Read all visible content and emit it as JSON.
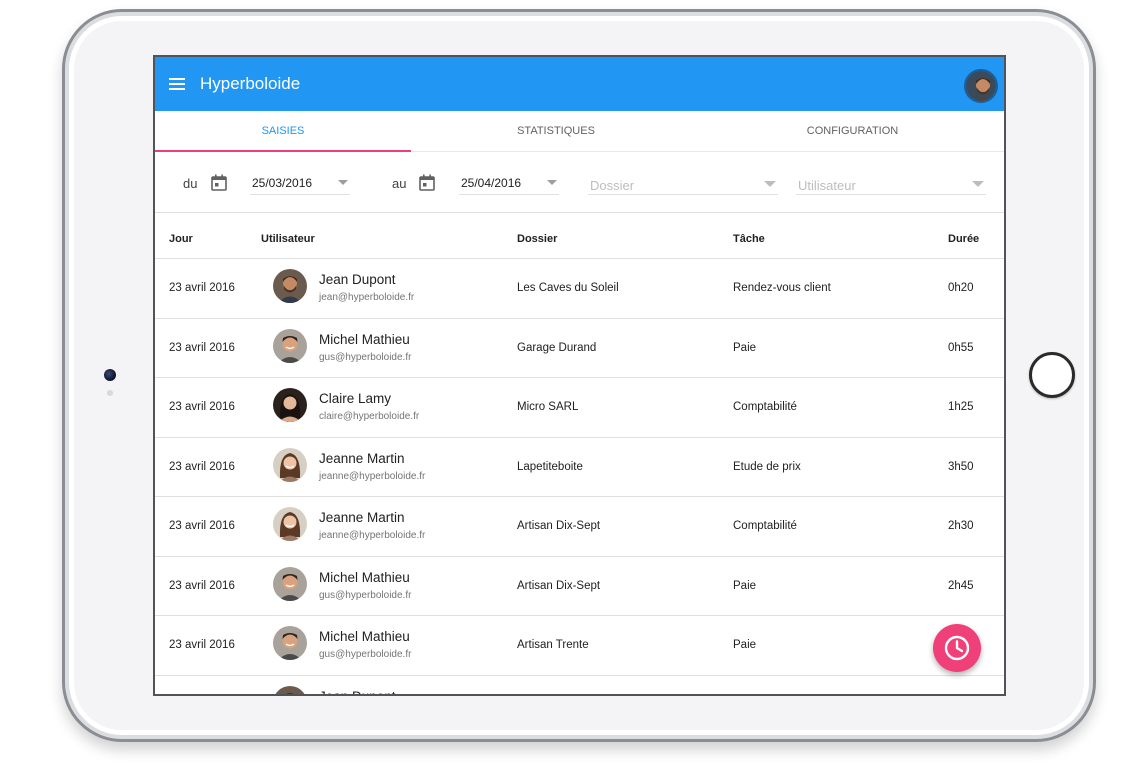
{
  "app": {
    "title": "Hyperboloide"
  },
  "tabs": [
    {
      "label": "Saisies",
      "active": true
    },
    {
      "label": "Statistiques",
      "active": false
    },
    {
      "label": "Configuration",
      "active": false
    }
  ],
  "filters": {
    "from_label": "du",
    "from_date": "25/03/2016",
    "to_label": "au",
    "to_date": "25/04/2016",
    "dossier_placeholder": "Dossier",
    "utilisateur_placeholder": "Utilisateur"
  },
  "table": {
    "headers": {
      "jour": "Jour",
      "utilisateur": "Utilisateur",
      "dossier": "Dossier",
      "tache": "Tâche",
      "duree": "Durée"
    },
    "rows": [
      {
        "jour": "23 avril 2016",
        "name": "Jean Dupont",
        "email": "jean@hyperboloide.fr",
        "dossier": "Les Caves du Soleil",
        "tache": "Rendez-vous client",
        "duree": "0h20",
        "avatar": "man-beard"
      },
      {
        "jour": "23 avril 2016",
        "name": "Michel Mathieu",
        "email": "gus@hyperboloide.fr",
        "dossier": "Garage Durand",
        "tache": "Paie",
        "duree": "0h55",
        "avatar": "man-smile"
      },
      {
        "jour": "23 avril 2016",
        "name": "Claire Lamy",
        "email": "claire@hyperboloide.fr",
        "dossier": "Micro SARL",
        "tache": "Comptabilité",
        "duree": "1h25",
        "avatar": "woman-dark"
      },
      {
        "jour": "23 avril 2016",
        "name": "Jeanne Martin",
        "email": "jeanne@hyperboloide.fr",
        "dossier": "Lapetiteboite",
        "tache": "Etude de prix",
        "duree": "3h50",
        "avatar": "woman-brown"
      },
      {
        "jour": "23 avril 2016",
        "name": "Jeanne Martin",
        "email": "jeanne@hyperboloide.fr",
        "dossier": "Artisan Dix-Sept",
        "tache": "Comptabilité",
        "duree": "2h30",
        "avatar": "woman-brown"
      },
      {
        "jour": "23 avril 2016",
        "name": "Michel Mathieu",
        "email": "gus@hyperboloide.fr",
        "dossier": "Artisan Dix-Sept",
        "tache": "Paie",
        "duree": "2h45",
        "avatar": "man-smile"
      },
      {
        "jour": "23 avril 2016",
        "name": "Michel Mathieu",
        "email": "gus@hyperboloide.fr",
        "dossier": "Artisan Trente",
        "tache": "Paie",
        "duree": "",
        "avatar": "man-smile"
      },
      {
        "jour": "",
        "name": "Jean Dupont",
        "email": "",
        "dossier": "",
        "tache": "",
        "duree": "",
        "avatar": "man-beard"
      }
    ]
  },
  "icons": {
    "menu": "menu-icon",
    "calendar": "calendar-icon",
    "dropdown": "chevron-down-icon",
    "fab": "clock-icon"
  },
  "colors": {
    "primary": "#2196f3",
    "accent": "#f0407a",
    "tab_ink": "#ec407a"
  }
}
